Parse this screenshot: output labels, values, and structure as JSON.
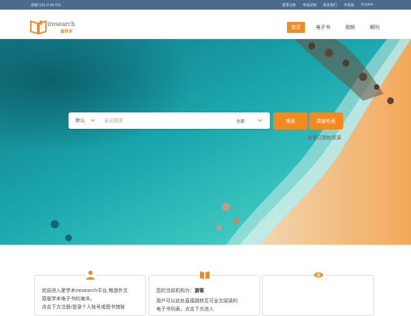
{
  "topbar": {
    "guest": "游客(192.0.00.00)",
    "links": [
      "登录注册",
      "申请试用",
      "联系我们",
      "手机版",
      "English"
    ]
  },
  "header": {
    "brand": "iresearch",
    "brand_sub": "爱学术",
    "nav": [
      {
        "label": "首页",
        "active": true
      },
      {
        "label": "电子书",
        "active": false
      },
      {
        "label": "视频",
        "active": false
      },
      {
        "label": "期刊",
        "active": false
      }
    ]
  },
  "search": {
    "scope": "默认",
    "placeholder": "全站搜索",
    "type": "全部",
    "search_label": "搜索",
    "advanced_label": "高级检索",
    "auth_link": "仅看已授权资源"
  },
  "cards": {
    "c1_line1": "欢迎进入爱学术iresearch平台,畅游外文",
    "c1_line2": "原版学术电子书的海洋。",
    "c1_line3": "点击下方注册/登录个人账号或图书馆账",
    "c2_prefix": "您的当前机构为：",
    "c2_org": "游客",
    "c2_line2": "用户可以此处直接跳转至可全文阅读的",
    "c2_line3": "电子书列表，点击下方进入"
  },
  "colors": {
    "accent": "#f08a23",
    "topbar": "#4b6a8c"
  }
}
